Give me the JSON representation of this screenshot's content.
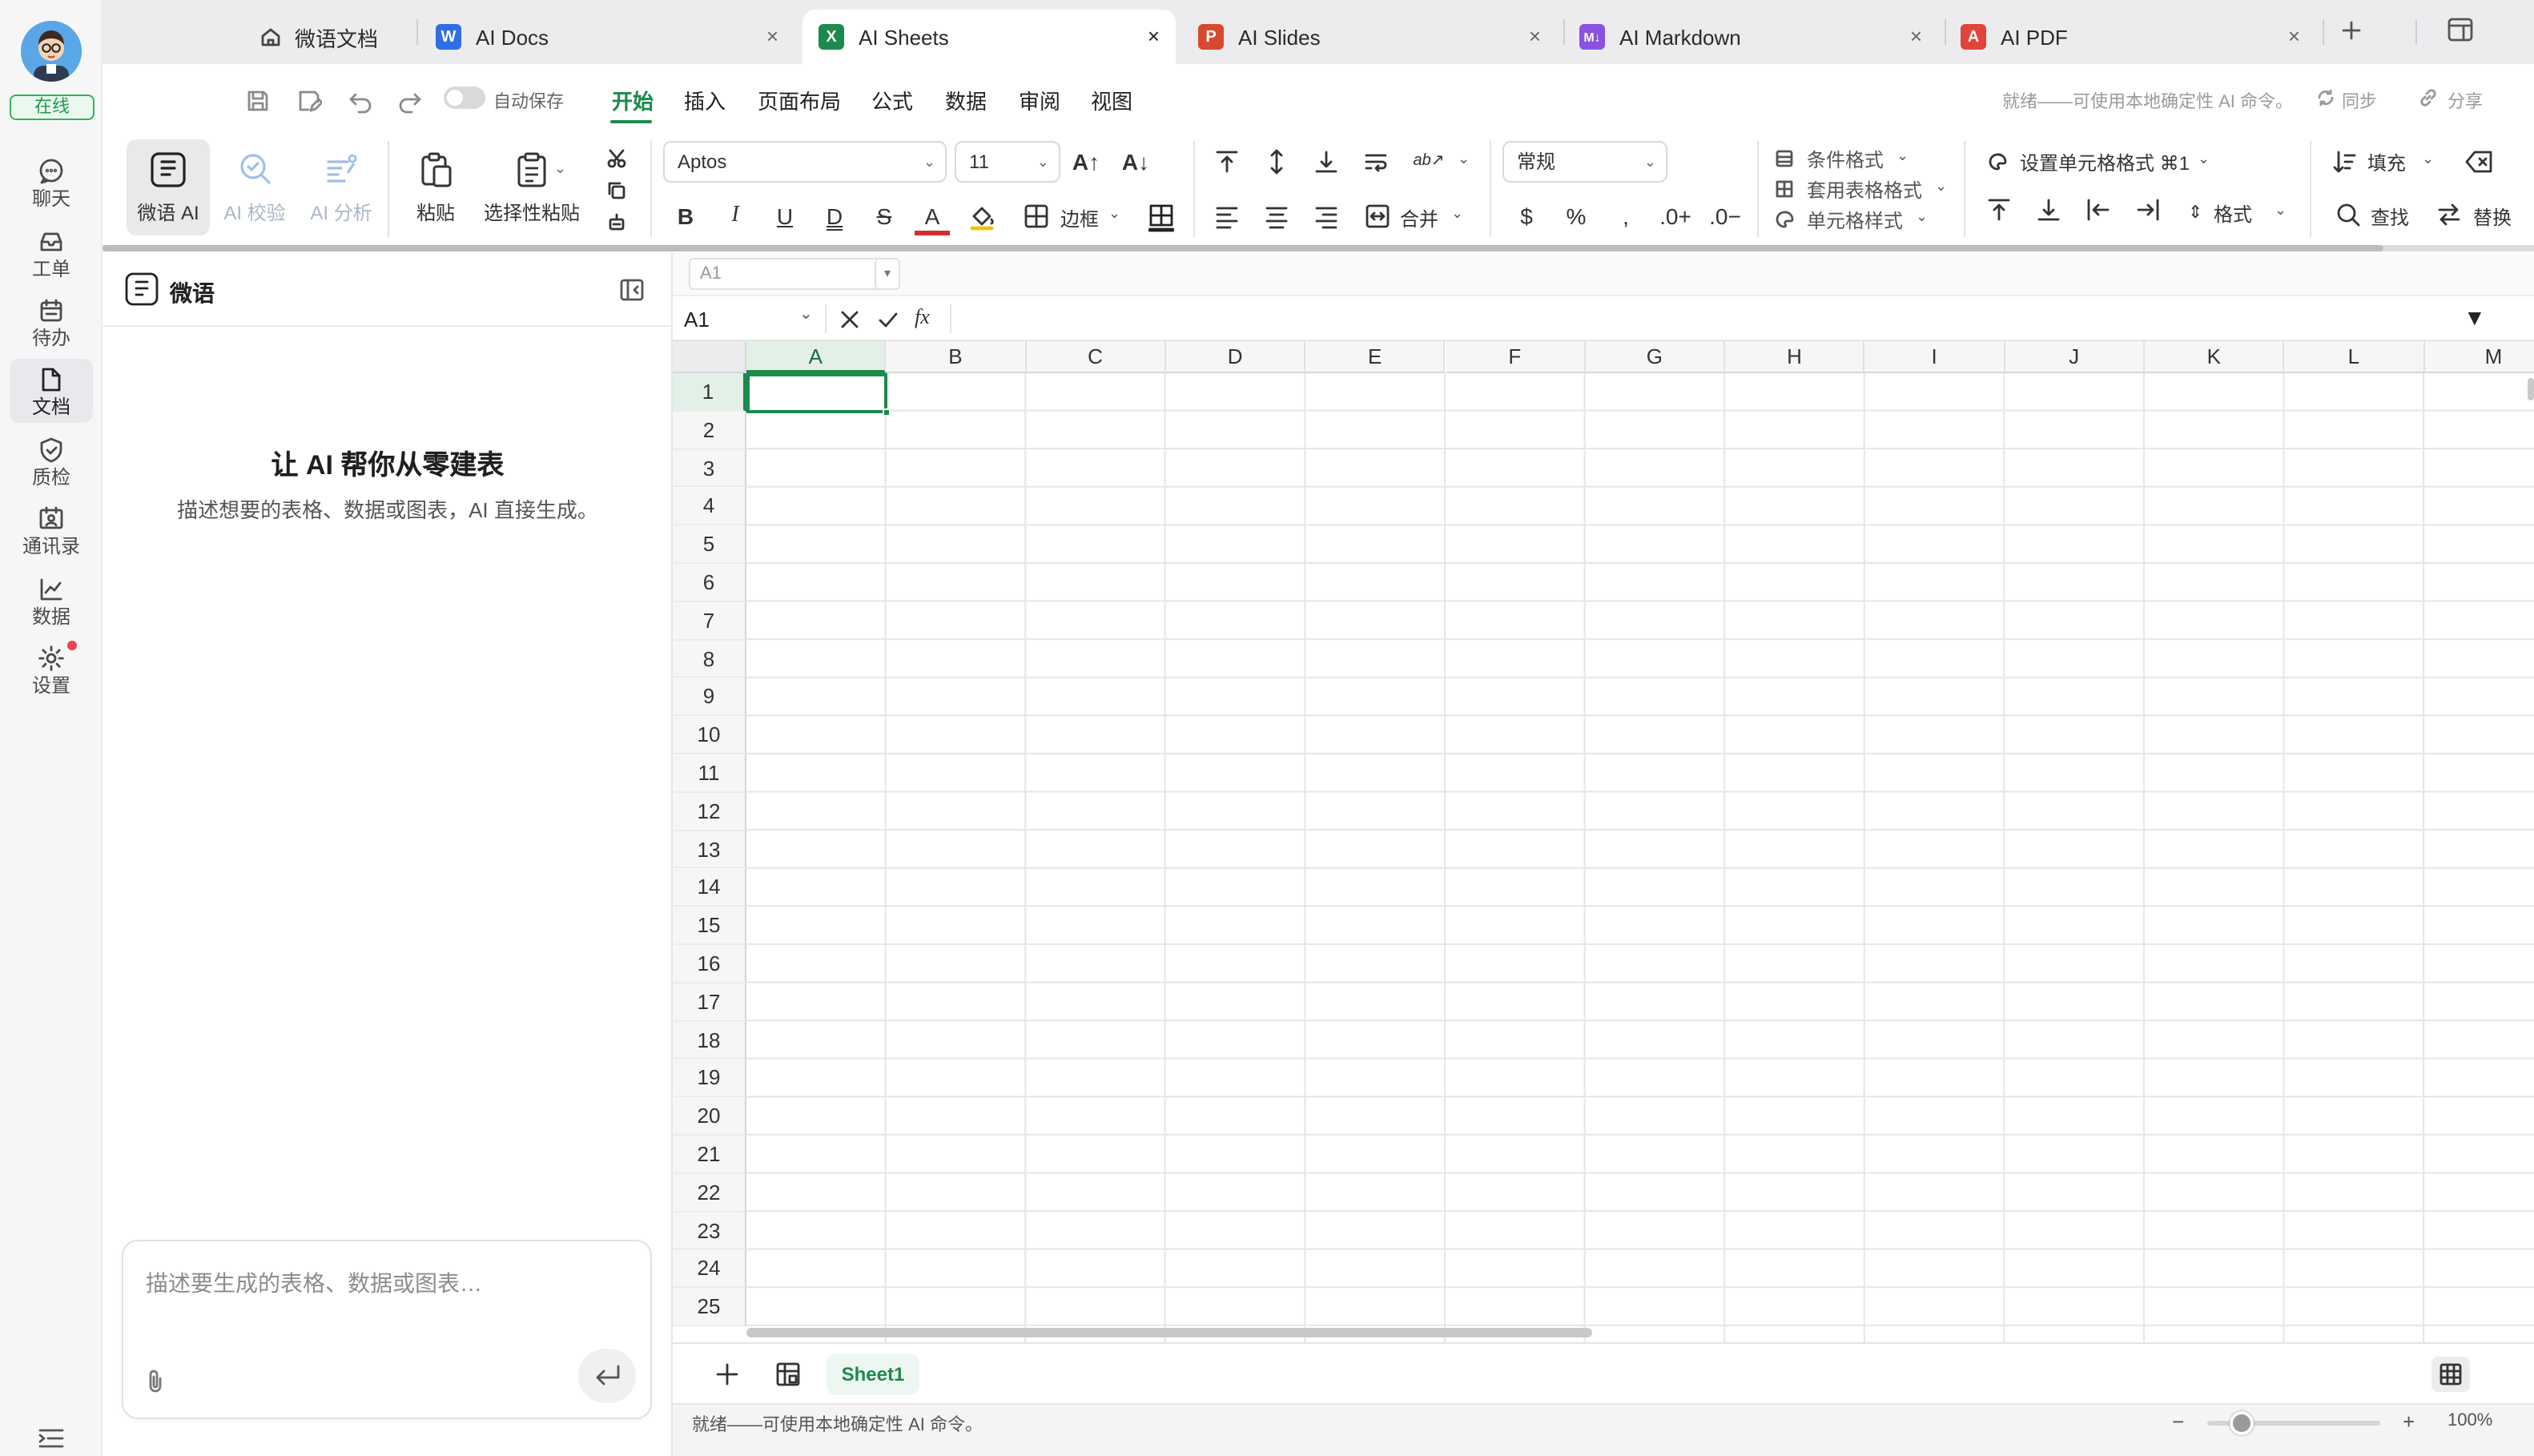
{
  "rail": {
    "status": "在线",
    "items": [
      {
        "label": "聊天",
        "icon": "chat-icon"
      },
      {
        "label": "工单",
        "icon": "ticket-icon"
      },
      {
        "label": "待办",
        "icon": "calendar-icon"
      },
      {
        "label": "文档",
        "icon": "document-icon",
        "active": true
      },
      {
        "label": "质检",
        "icon": "shield-check-icon"
      },
      {
        "label": "通讯录",
        "icon": "contacts-icon"
      },
      {
        "label": "数据",
        "icon": "chart-line-icon"
      },
      {
        "label": "设置",
        "icon": "gear-icon"
      }
    ]
  },
  "tabs": [
    {
      "label": "微语文档",
      "icon": "home-icon"
    },
    {
      "label": "AI Docs",
      "icon": "word-icon",
      "badge": "W",
      "color": "#2f6ee6"
    },
    {
      "label": "AI Sheets",
      "icon": "excel-icon",
      "badge": "X",
      "color": "#1d8a4d",
      "active": true
    },
    {
      "label": "AI Slides",
      "icon": "powerpoint-icon",
      "badge": "P",
      "color": "#d84a2f"
    },
    {
      "label": "AI Markdown",
      "icon": "markdown-icon",
      "badge": "M↓",
      "color": "#8a52e0"
    },
    {
      "label": "AI PDF",
      "icon": "pdf-icon",
      "badge": "A",
      "color": "#e0443a"
    }
  ],
  "toolbar": {
    "autosave_label": "自动保存",
    "menus": [
      "开始",
      "插入",
      "页面布局",
      "公式",
      "数据",
      "审阅",
      "视图"
    ],
    "status": "就绪——可使用本地确定性 AI 命令。",
    "sync_label": "同步",
    "share_label": "分享",
    "weiyu_ai": "微语 AI",
    "ai_check": "AI 校验",
    "ai_analysis": "AI 分析",
    "paste": "粘贴",
    "paste_special": "选择性粘贴",
    "font_name": "Aptos",
    "font_size": "11",
    "border_label": "边框",
    "merge_label": "合并",
    "number_format": "常规",
    "cond_format": "条件格式",
    "table_format": "套用表格格式",
    "cell_style": "单元格样式",
    "set_cell_format": "设置单元格格式 ⌘1",
    "format_label": "格式",
    "fill_label": "填充",
    "find_label": "查找",
    "replace_label": "替换"
  },
  "panel": {
    "title": "微语",
    "heading": "让 AI 帮你从零建表",
    "subheading": "描述想要的表格、数据或图表，AI 直接生成。",
    "input_placeholder": "描述要生成的表格、数据或图表…"
  },
  "sheet": {
    "name_box_small": "A1",
    "name_box": "A1",
    "fx": "fx",
    "columns": [
      "A",
      "B",
      "C",
      "D",
      "E",
      "F",
      "G",
      "H",
      "I",
      "J",
      "K",
      "L",
      "M"
    ],
    "rows": [
      "1",
      "2",
      "3",
      "4",
      "5",
      "6",
      "7",
      "8",
      "9",
      "10",
      "11",
      "12",
      "13",
      "14",
      "15",
      "16",
      "17",
      "18",
      "19",
      "20",
      "21",
      "22",
      "23",
      "24",
      "25"
    ],
    "selected_cell": "A1",
    "sheet_tab": "Sheet1"
  },
  "statusbar": {
    "text": "就绪——可使用本地确定性 AI 命令。",
    "zoom_minus": "−",
    "zoom_plus": "+",
    "zoom": "100%"
  }
}
